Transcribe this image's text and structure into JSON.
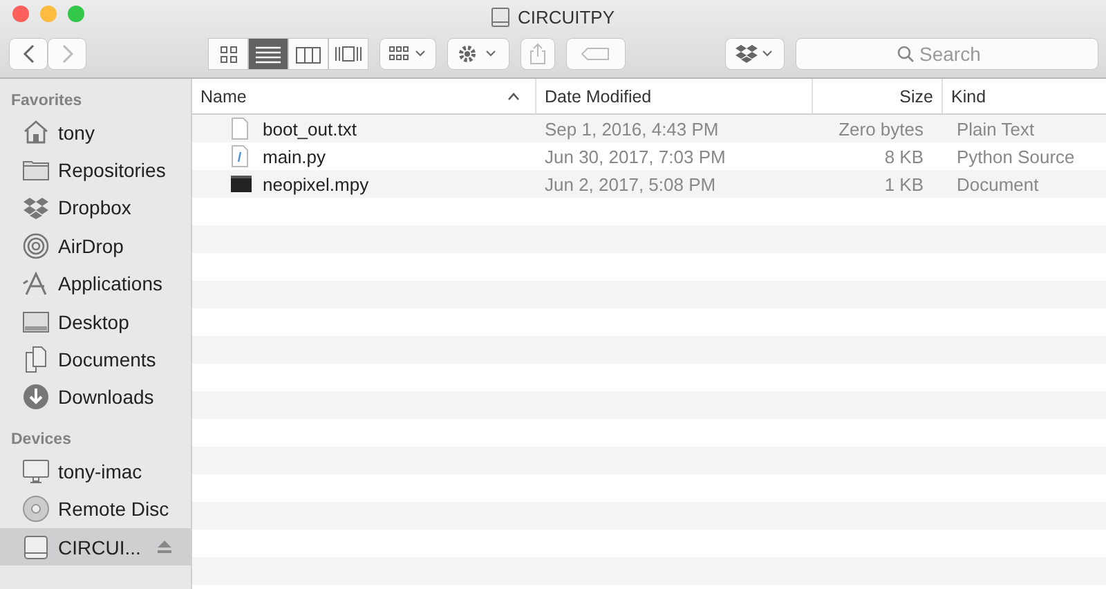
{
  "window": {
    "title": "CIRCUITPY"
  },
  "toolbar": {
    "view_modes": [
      {
        "kind": "icons",
        "selected": false
      },
      {
        "kind": "list",
        "selected": true
      },
      {
        "kind": "columns",
        "selected": false
      },
      {
        "kind": "coverflow",
        "selected": false
      }
    ],
    "search": {
      "placeholder": "Search"
    }
  },
  "sidebar": {
    "sections": [
      {
        "title": "Favorites",
        "items": [
          {
            "kind": "home",
            "label": "tony",
            "selected": false
          },
          {
            "kind": "folder",
            "label": "Repositories",
            "selected": false
          },
          {
            "kind": "dropbox",
            "label": "Dropbox",
            "selected": false
          },
          {
            "kind": "airdrop",
            "label": "AirDrop",
            "selected": false
          },
          {
            "kind": "apps",
            "label": "Applications",
            "selected": false
          },
          {
            "kind": "desktop",
            "label": "Desktop",
            "selected": false
          },
          {
            "kind": "documents",
            "label": "Documents",
            "selected": false
          },
          {
            "kind": "downloads",
            "label": "Downloads",
            "selected": false
          }
        ]
      },
      {
        "title": "Devices",
        "items": [
          {
            "kind": "imac",
            "label": "tony-imac",
            "selected": false
          },
          {
            "kind": "disc",
            "label": "Remote Disc",
            "selected": false
          },
          {
            "kind": "drive",
            "label": "CIRCUI...",
            "selected": true,
            "ejectable": true
          }
        ]
      }
    ]
  },
  "table": {
    "columns": [
      "Name",
      "Date Modified",
      "Size",
      "Kind"
    ],
    "rows": [
      {
        "kind": "text",
        "name": "boot_out.txt",
        "date": "Sep 1, 2016, 4:43 PM",
        "size": "Zero bytes",
        "type": "Plain Text"
      },
      {
        "kind": "python",
        "name": "main.py",
        "date": "Jun 30, 2017, 7:03 PM",
        "size": "8 KB",
        "type": "Python Source"
      },
      {
        "kind": "binary",
        "name": "neopixel.mpy",
        "date": "Jun 2, 2017, 5:08 PM",
        "size": "1 KB",
        "type": "Document"
      }
    ]
  }
}
